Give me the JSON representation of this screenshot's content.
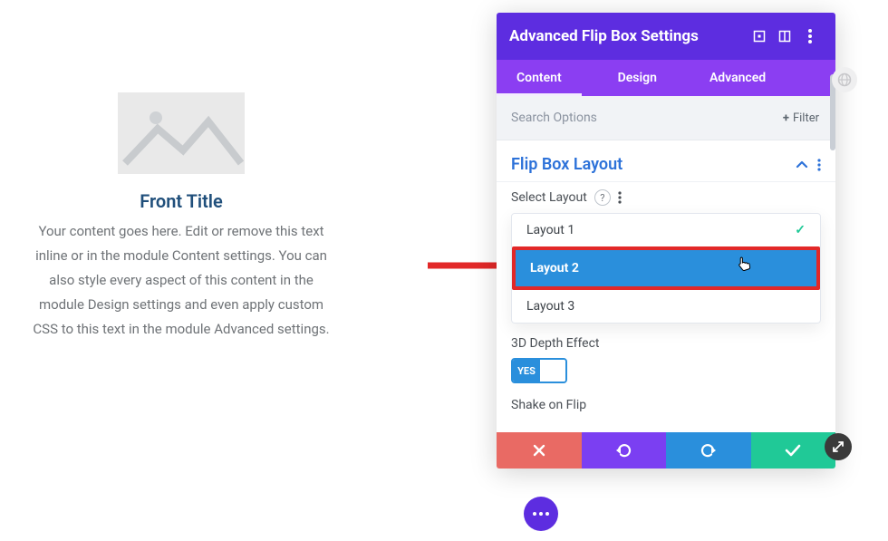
{
  "preview": {
    "title": "Front Title",
    "content": "Your content goes here. Edit or remove this text inline or in the module Content settings. You can also style every aspect of this content in the module Design settings and even apply custom CSS to this text in the module Advanced settings."
  },
  "panel": {
    "title": "Advanced Flip Box Settings",
    "tabs": {
      "content": "Content",
      "design": "Design",
      "advanced": "Advanced"
    },
    "search_placeholder": "Search Options",
    "filter_label": "Filter"
  },
  "section": {
    "title": "Flip Box Layout",
    "select_label": "Select Layout",
    "options": {
      "opt1": "Layout 1",
      "opt2": "Layout 2",
      "opt3": "Layout 3"
    },
    "depth_label": "3D Depth Effect",
    "toggle_yes": "YES",
    "shake_label": "Shake on Flip"
  }
}
